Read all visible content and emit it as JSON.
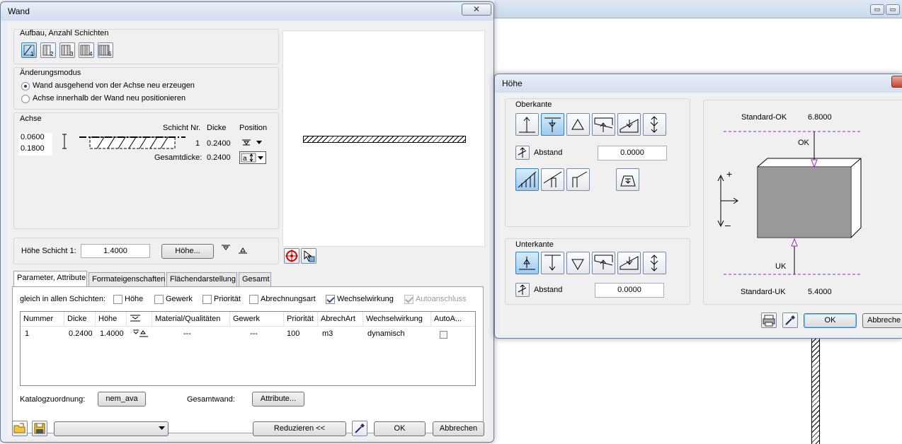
{
  "background_window": {
    "min_label": "▭",
    "max_label": "▭"
  },
  "wand": {
    "title": "Wand",
    "close": "✕",
    "aufbau": {
      "legend": "Aufbau, Anzahl Schichten",
      "layers": [
        "1",
        "2",
        "3",
        "4",
        "5"
      ]
    },
    "mode": {
      "legend": "Änderungsmodus",
      "option1": "Wand ausgehend von der Achse neu erzeugen",
      "option2": "Achse innerhalb der Wand neu positionieren"
    },
    "achse": {
      "legend": "Achse",
      "val1": "0.0600",
      "val2": "0.1800",
      "col_schicht": "Schicht Nr.",
      "col_dicke": "Dicke",
      "col_position": "Position",
      "row_nr": "1",
      "row_dicke": "0.2400",
      "gesamt_label": "Gesamtdicke:",
      "gesamt_val": "0.2400"
    },
    "hoehe": {
      "label": "Höhe Schicht 1:",
      "value": "1.4000",
      "button": "Höhe..."
    },
    "tabs": [
      "Parameter, Attribute",
      "Formateigenschaften",
      "Flächendarstellung",
      "Gesamt"
    ],
    "gleich": {
      "label": "gleich in allen Schichten:",
      "items": [
        "Höhe",
        "Gewerk",
        "Priorität",
        "Abrechnungsart",
        "Wechselwirkung",
        "Autoanschluss"
      ]
    },
    "table": {
      "headers": [
        "Nummer",
        "Dicke",
        "Höhe",
        "",
        "Material/Qualitäten",
        "Gewerk",
        "Priorität",
        "AbrechArt",
        "Wechselwirkung",
        "AutoA..."
      ],
      "row": [
        "1",
        "0.2400",
        "1.4000",
        "",
        "---",
        "---",
        "100",
        "m3",
        "dynamisch",
        ""
      ]
    },
    "katalog": {
      "label": "Katalogzuordnung:",
      "button": "nem_ava"
    },
    "gesamtwand": {
      "label": "Gesamtwand:",
      "button": "Attribute..."
    },
    "footer": {
      "dropdown": "",
      "reduzieren": "Reduzieren <<",
      "ok": "OK",
      "abbrechen": "Abbrechen"
    }
  },
  "hoehe_dialog": {
    "title": "Höhe",
    "oberkante": {
      "legend": "Oberkante",
      "abstand_label": "Abstand",
      "abstand_val": "0.0000"
    },
    "unterkante": {
      "legend": "Unterkante",
      "abstand_label": "Abstand",
      "abstand_val": "0.0000"
    },
    "diagram": {
      "std_ok_label": "Standard-OK",
      "std_ok_val": "6.8000",
      "ok": "OK",
      "uk": "UK",
      "std_uk_label": "Standard-UK",
      "std_uk_val": "5.4000",
      "plus": "+",
      "minus": "–"
    },
    "footer": {
      "ok": "OK",
      "abbrechen": "Abbreche"
    }
  }
}
